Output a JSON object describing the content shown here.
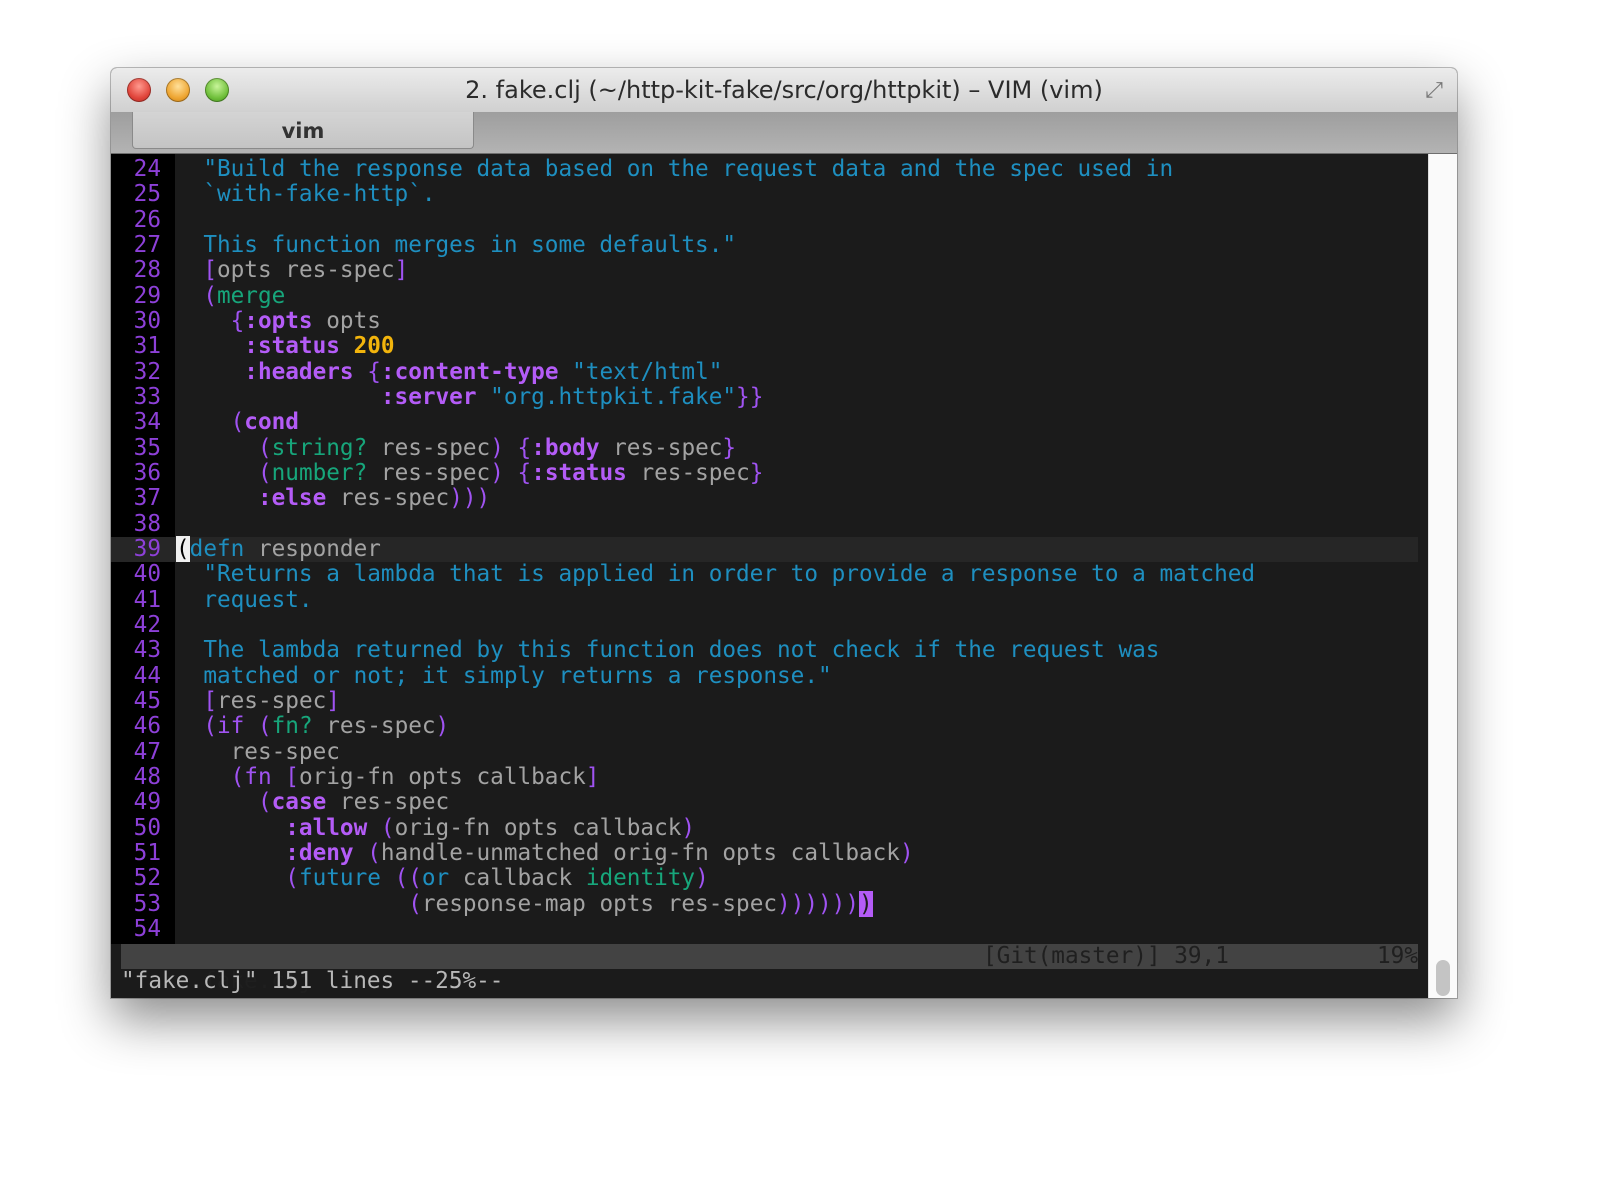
{
  "window": {
    "title": "2. fake.clj (~/http-kit-fake/src/org/httpkit) – VIM (vim)",
    "tab": "vim",
    "fullscreen_icon": "⤢"
  },
  "colors": {
    "string": "#1e8fc0",
    "keyword": "#b45cf7",
    "paren": "#a053f2",
    "text": "#a3a3a3",
    "function": "#17a67b",
    "number": "#f2b40c",
    "line_number": "#8d40d8"
  },
  "lines": [
    {
      "n": "24",
      "tokens": [
        [
          "t",
          "  "
        ],
        [
          "s",
          "\"Build the response data based on the request data and the spec used in"
        ]
      ]
    },
    {
      "n": "25",
      "tokens": [
        [
          "s",
          "  `with-fake-http`."
        ]
      ]
    },
    {
      "n": "26",
      "tokens": []
    },
    {
      "n": "27",
      "tokens": [
        [
          "s",
          "  This function merges in some defaults.\""
        ]
      ]
    },
    {
      "n": "28",
      "tokens": [
        [
          "p",
          "  ["
        ],
        [
          "t",
          "opts res-spec"
        ],
        [
          "p",
          "]"
        ]
      ]
    },
    {
      "n": "29",
      "tokens": [
        [
          "p",
          "  ("
        ],
        [
          "g",
          "merge"
        ]
      ]
    },
    {
      "n": "30",
      "tokens": [
        [
          "p",
          "    {"
        ],
        [
          "k",
          ":opts"
        ],
        [
          "t",
          " opts"
        ]
      ]
    },
    {
      "n": "31",
      "tokens": [
        [
          "k",
          "     :status"
        ],
        [
          "n",
          " 200"
        ]
      ]
    },
    {
      "n": "32",
      "tokens": [
        [
          "k",
          "     :headers"
        ],
        [
          "p",
          " {"
        ],
        [
          "k",
          ":content-type"
        ],
        [
          "s",
          " \"text/html\""
        ]
      ]
    },
    {
      "n": "33",
      "tokens": [
        [
          "k",
          "               :server"
        ],
        [
          "s",
          " \"org.httpkit.fake\""
        ],
        [
          "p",
          "}}"
        ]
      ]
    },
    {
      "n": "34",
      "tokens": [
        [
          "p",
          "    ("
        ],
        [
          "k",
          "cond"
        ]
      ]
    },
    {
      "n": "35",
      "tokens": [
        [
          "p",
          "      ("
        ],
        [
          "g",
          "string?"
        ],
        [
          "t",
          " res-spec"
        ],
        [
          "p",
          ")"
        ],
        [
          "p",
          " {"
        ],
        [
          "k",
          ":body"
        ],
        [
          "t",
          " res-spec"
        ],
        [
          "p",
          "}"
        ]
      ]
    },
    {
      "n": "36",
      "tokens": [
        [
          "p",
          "      ("
        ],
        [
          "g",
          "number?"
        ],
        [
          "t",
          " res-spec"
        ],
        [
          "p",
          ")"
        ],
        [
          "p",
          " {"
        ],
        [
          "k",
          ":status"
        ],
        [
          "t",
          " res-spec"
        ],
        [
          "p",
          "}"
        ]
      ]
    },
    {
      "n": "37",
      "tokens": [
        [
          "k",
          "      :else"
        ],
        [
          "t",
          " res-spec"
        ],
        [
          "p",
          ")))"
        ]
      ]
    },
    {
      "n": "38",
      "tokens": []
    },
    {
      "n": "39",
      "current": true,
      "tokens": [
        [
          "cursor",
          "("
        ],
        [
          "b",
          "defn"
        ],
        [
          "t",
          " responder"
        ]
      ]
    },
    {
      "n": "40",
      "tokens": [
        [
          "s",
          "  \"Returns a lambda that is applied in order to provide a response to a matched"
        ]
      ]
    },
    {
      "n": "41",
      "tokens": [
        [
          "s",
          "  request."
        ]
      ]
    },
    {
      "n": "42",
      "tokens": []
    },
    {
      "n": "43",
      "tokens": [
        [
          "s",
          "  The lambda returned by this function does not check if the request was"
        ]
      ]
    },
    {
      "n": "44",
      "tokens": [
        [
          "s",
          "  matched or not; it simply returns a response.\""
        ]
      ]
    },
    {
      "n": "45",
      "tokens": [
        [
          "p",
          "  ["
        ],
        [
          "t",
          "res-spec"
        ],
        [
          "p",
          "]"
        ]
      ]
    },
    {
      "n": "46",
      "tokens": [
        [
          "p",
          "  (if ("
        ],
        [
          "g",
          "fn?"
        ],
        [
          "t",
          " res-spec"
        ],
        [
          "p",
          ")"
        ]
      ]
    },
    {
      "n": "47",
      "tokens": [
        [
          "t",
          "    res-spec"
        ]
      ]
    },
    {
      "n": "48",
      "tokens": [
        [
          "p",
          "    (fn ["
        ],
        [
          "t",
          "orig-fn opts callback"
        ],
        [
          "p",
          "]"
        ]
      ]
    },
    {
      "n": "49",
      "tokens": [
        [
          "p",
          "      ("
        ],
        [
          "k",
          "case"
        ],
        [
          "t",
          " res-spec"
        ]
      ]
    },
    {
      "n": "50",
      "tokens": [
        [
          "k",
          "        :allow"
        ],
        [
          "p",
          " ("
        ],
        [
          "t",
          "orig-fn opts callback"
        ],
        [
          "p",
          ")"
        ]
      ]
    },
    {
      "n": "51",
      "tokens": [
        [
          "k",
          "        :deny"
        ],
        [
          "p",
          " ("
        ],
        [
          "t",
          "handle-unmatched orig-fn opts callback"
        ],
        [
          "p",
          ")"
        ]
      ]
    },
    {
      "n": "52",
      "tokens": [
        [
          "p",
          "        ("
        ],
        [
          "b",
          "future"
        ],
        [
          "p",
          " (("
        ],
        [
          "b",
          "or"
        ],
        [
          "t",
          " callback "
        ],
        [
          "g",
          "identity"
        ],
        [
          "p",
          ")"
        ]
      ]
    },
    {
      "n": "53",
      "tokens": [
        [
          "t",
          "                 "
        ],
        [
          "p",
          "("
        ],
        [
          "t",
          "response-map opts res-spec"
        ],
        [
          "p",
          "))))))"
        ],
        [
          "hl",
          ")"
        ]
      ]
    },
    {
      "n": "54",
      "tokens": []
    }
  ],
  "statusline": {
    "file": "fake.clj",
    "git": "[Git(master)] 39,1",
    "percent": "19%"
  },
  "cmdline": "\"fake.clj\" 151 lines --25%--"
}
